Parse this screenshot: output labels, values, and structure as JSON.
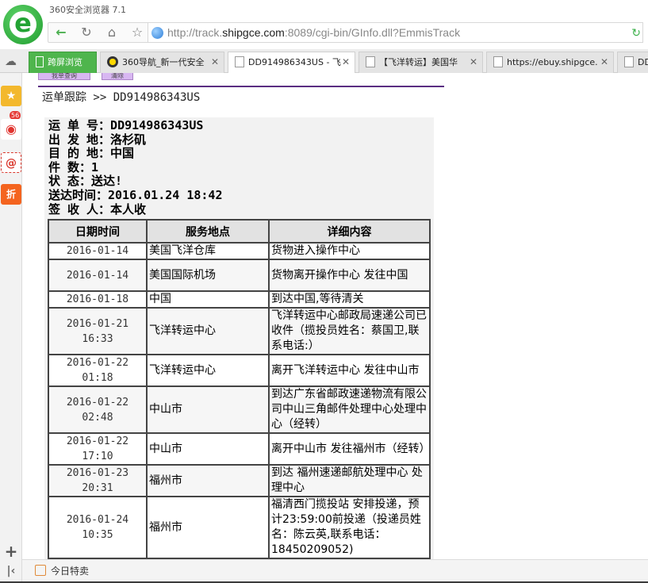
{
  "browser": {
    "title": "360安全浏览器 7.1",
    "url": {
      "prefix": "http://track.",
      "domain": "shipgce.com",
      "suffix": ":8089/cgi-bin/GInfo.dll?EmmisTrack"
    },
    "tabs": [
      {
        "label": "跨屏浏览",
        "active": false
      },
      {
        "label": "360导航_新一代安全",
        "active": false
      },
      {
        "label": "DD914986343US - 飞",
        "active": true
      },
      {
        "label": "【飞洋转运】美国华",
        "active": false
      },
      {
        "label": "https://ebuy.shipgce.",
        "active": false
      },
      {
        "label": "DD",
        "active": false
      }
    ],
    "sidebar_badge": "56",
    "statusbar": {
      "label": "今日特卖"
    }
  },
  "page": {
    "top_buttons": {
      "query": "我单查询",
      "clear": "清除"
    },
    "breadcrumb": "运单跟踪 >> DD914986343US",
    "info": {
      "waybill": "运 单 号：DD914986343US",
      "origin": "出 发 地：洛杉矶",
      "destination": "目 的 地：中国",
      "pieces": "件  数：1",
      "status": "状  态：送达!",
      "delivered_time": "送达时间：2016.01.24 18:42",
      "signer": "签 收 人：本人收"
    },
    "table": {
      "headers": [
        "日期时间",
        "服务地点",
        "详细内容"
      ],
      "rows": [
        {
          "date": "2016-01-14",
          "time": "",
          "location": "美国飞洋仓库",
          "detail": "货物进入操作中心"
        },
        {
          "date": "2016-01-14",
          "time": "",
          "location": "美国国际机场",
          "detail": "货物离开操作中心 发往中国"
        },
        {
          "date": "2016-01-18",
          "time": "",
          "location": "中国",
          "detail": "到达中国,等待清关"
        },
        {
          "date": "2016-01-21",
          "time": "16:33",
          "location": "飞洋转运中心",
          "detail": "飞洋转运中心邮政局速递公司已收件（揽投员姓名：蔡国卫,联系电话:）"
        },
        {
          "date": "2016-01-22",
          "time": "01:18",
          "location": "飞洋转运中心",
          "detail": "离开飞洋转运中心 发往中山市"
        },
        {
          "date": "2016-01-22",
          "time": "02:48",
          "location": "中山市",
          "detail": "到达广东省邮政速递物流有限公司中山三角邮件处理中心处理中心（经转）"
        },
        {
          "date": "2016-01-22",
          "time": "17:10",
          "location": "中山市",
          "detail": "离开中山市 发往福州市（经转）"
        },
        {
          "date": "2016-01-23",
          "time": "20:31",
          "location": "福州市",
          "detail": "到达 福州速递邮航处理中心 处理中心"
        },
        {
          "date": "2016-01-24",
          "time": "10:35",
          "location": "福州市",
          "detail": "福清西门揽投站 安排投递，预计23:59:00前投递（投递员姓名：陈云英,联系电话：18450209052)"
        },
        {
          "date": "",
          "time": "",
          "location": "",
          "detail": ""
        }
      ]
    }
  },
  "colors": {
    "accent_green": "#4fb54d",
    "purple_rule": "#5a2d82",
    "button_purple": "#d8b7f2"
  }
}
